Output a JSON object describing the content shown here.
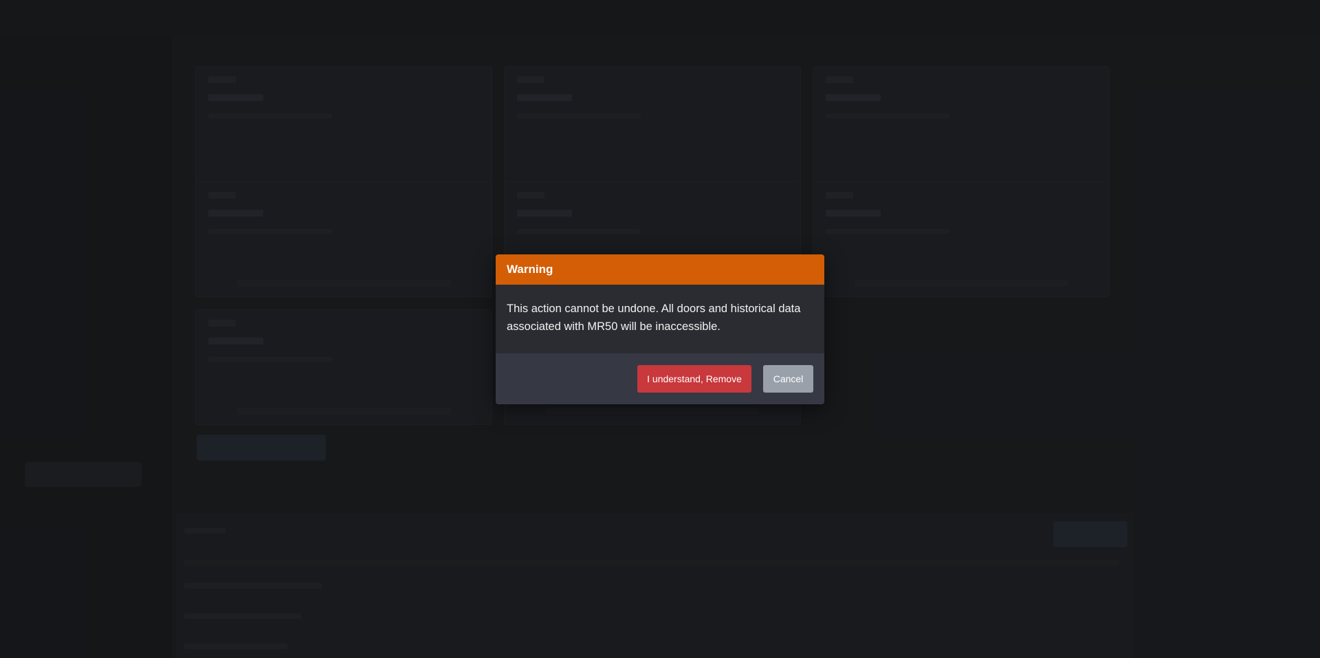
{
  "dialog": {
    "title": "Warning",
    "message": "This action cannot be undone. All doors and historical data associated with MR50 will be inaccessible.",
    "confirm_label": "I understand, Remove",
    "cancel_label": "Cancel"
  },
  "colors": {
    "header": "#d35e05",
    "danger": "#c8383c",
    "cancel": "#9aa0aa"
  }
}
